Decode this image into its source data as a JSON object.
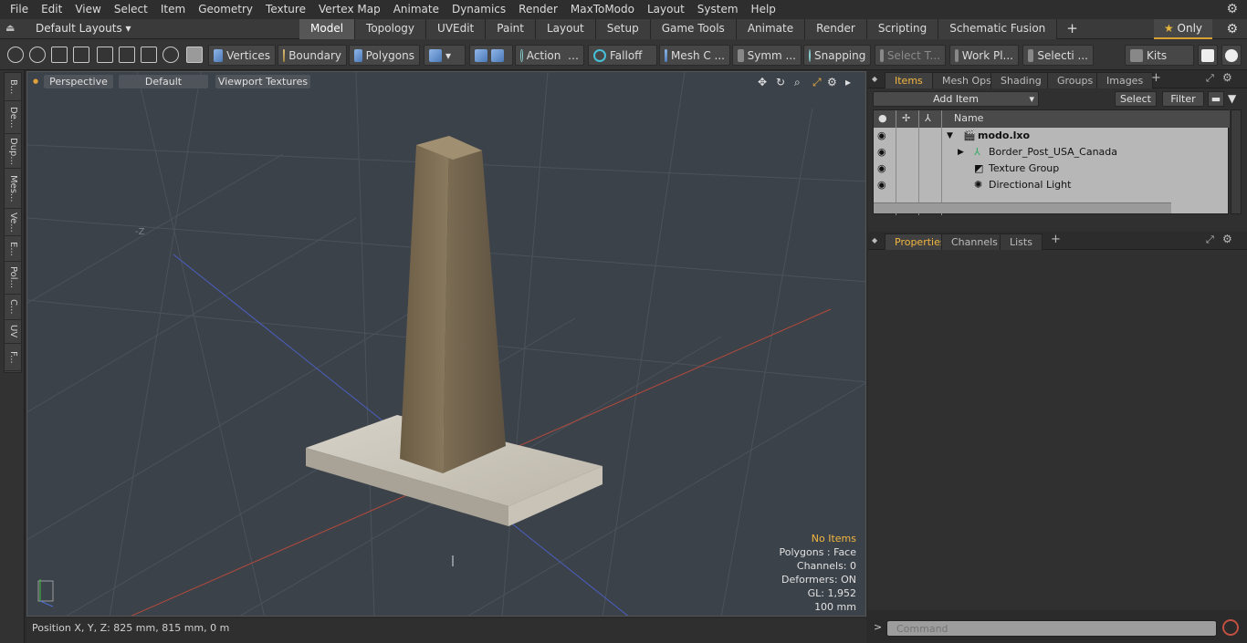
{
  "menubar": {
    "items": [
      "File",
      "Edit",
      "View",
      "Select",
      "Item",
      "Geometry",
      "Texture",
      "Vertex Map",
      "Animate",
      "Dynamics",
      "Render",
      "MaxToModo",
      "Layout",
      "System",
      "Help"
    ]
  },
  "layouts": {
    "label": "Default Layouts ▾"
  },
  "tabs": [
    "Model",
    "Topology",
    "UVEdit",
    "Paint",
    "Layout",
    "Setup",
    "Game Tools",
    "Animate",
    "Render",
    "Scripting",
    "Schematic Fusion"
  ],
  "active_tab": "Model",
  "only_label": "Only",
  "toolbar": {
    "vertices": "Vertices",
    "boundary": "Boundary",
    "polygons": "Polygons",
    "action": "Action",
    "falloff": "Falloff",
    "meshc": "Mesh C ...",
    "symm": "Symm ...",
    "snapping": "Snapping",
    "selectt": "Select T...",
    "workpl": "Work Pl...",
    "selecti": "Selecti ...",
    "kits": "Kits"
  },
  "vtabs": [
    "B...",
    "De...",
    "Dup...",
    "Mes...",
    "Ve...",
    "E...",
    "Pol...",
    "C...",
    "UV",
    "F..."
  ],
  "viewport": {
    "perspective": "Perspective",
    "default": "Default",
    "textures": "Viewport Textures",
    "axis_label": "-Z",
    "hud": {
      "no_items": "No Items",
      "polygons": "Polygons : Face",
      "channels": "Channels: 0",
      "deformers": "Deformers: ON",
      "gl": "GL: 1,952",
      "scale": "100 mm"
    }
  },
  "status": {
    "position": "Position X, Y, Z:   825 mm, 815 mm, 0 m"
  },
  "items_panel": {
    "tabs": [
      "Items",
      "Mesh Ops",
      "Shading",
      "Groups",
      "Images"
    ],
    "add_item": "Add Item",
    "select": "Select",
    "filter": "Filter",
    "col_name": "Name",
    "rows": [
      {
        "name": "modo.lxo",
        "indent": 0
      },
      {
        "name": "Border_Post_USA_Canada",
        "indent": 1
      },
      {
        "name": "Texture Group",
        "indent": 1
      },
      {
        "name": "Directional Light",
        "indent": 1
      }
    ]
  },
  "props_panel": {
    "tabs": [
      "Properties",
      "Channels",
      "Lists"
    ]
  },
  "command": {
    "placeholder": "Command",
    "prompt": ">"
  },
  "colors": {
    "accent": "#f2b640",
    "viewport_bg": "#3c424a"
  }
}
